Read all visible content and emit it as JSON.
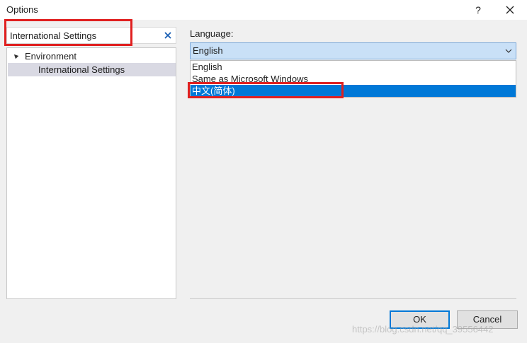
{
  "window": {
    "title": "Options",
    "help": "?"
  },
  "search": {
    "value": "International Settings"
  },
  "tree": {
    "items": [
      {
        "label": "Environment"
      },
      {
        "label": "International Settings"
      }
    ]
  },
  "language": {
    "label": "Language:",
    "selected": "English",
    "options": [
      "English",
      "Same as Microsoft Windows",
      "中文(简体)"
    ]
  },
  "buttons": {
    "ok": "OK",
    "cancel": "Cancel"
  },
  "watermark": "https://blog.csdn.net/qq_39556442",
  "colors": {
    "selection": "#0078d7",
    "highlight": "#e02020",
    "combo": "#c9e0f7"
  }
}
